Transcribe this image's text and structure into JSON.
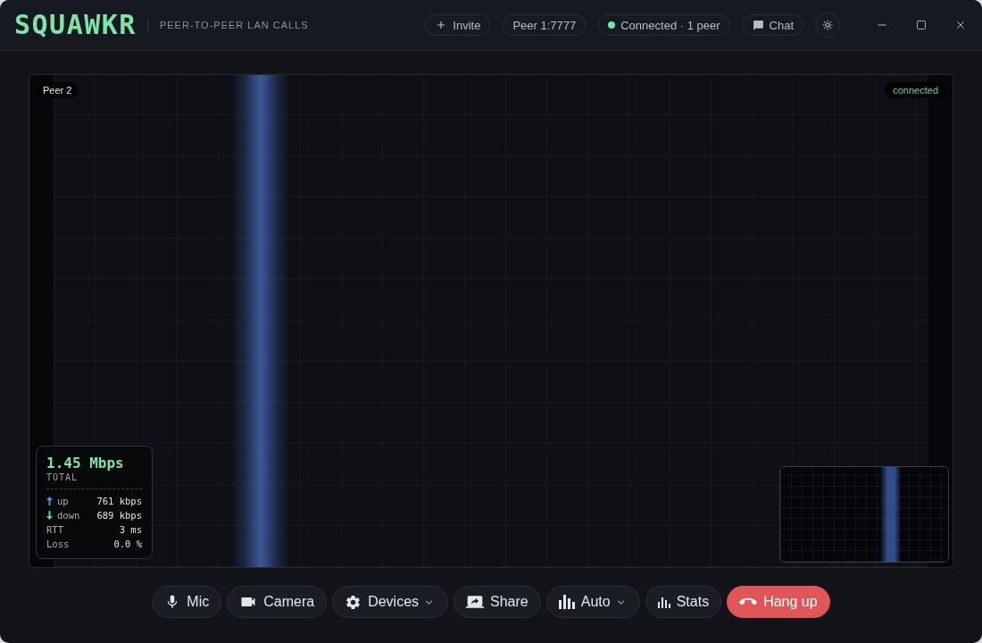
{
  "header": {
    "logo": "SQUAWKR",
    "tagline": "PEER-TO-PEER LAN CALLS",
    "invite": "Invite",
    "peer": "Peer 1:7777",
    "status": {
      "label": "Connected · 1 peer",
      "connected": true
    },
    "chat": "Chat"
  },
  "stage": {
    "peer_label": "Peer 2",
    "connection": "connected",
    "stats": {
      "total": "1.45 Mbps",
      "total_label": "TOTAL",
      "rows": [
        {
          "kind": "up",
          "label": "up",
          "value": "761 kbps"
        },
        {
          "kind": "down",
          "label": "down",
          "value": "689 kbps"
        },
        {
          "kind": "plain",
          "label": "RTT",
          "value": "3 ms"
        },
        {
          "kind": "plain",
          "label": "Loss",
          "value": "0.0 %"
        }
      ]
    }
  },
  "controls": [
    {
      "kind": "mic",
      "label": "Mic",
      "dropdown": false
    },
    {
      "kind": "camera",
      "label": "Camera",
      "dropdown": false
    },
    {
      "kind": "devices",
      "label": "Devices",
      "dropdown": true
    },
    {
      "kind": "share",
      "label": "Share",
      "dropdown": false
    },
    {
      "kind": "quality",
      "label": "Auto",
      "dropdown": true
    },
    {
      "kind": "stats",
      "label": "Stats",
      "dropdown": false
    },
    {
      "kind": "hangup",
      "label": "Hang up",
      "dropdown": false
    }
  ]
}
